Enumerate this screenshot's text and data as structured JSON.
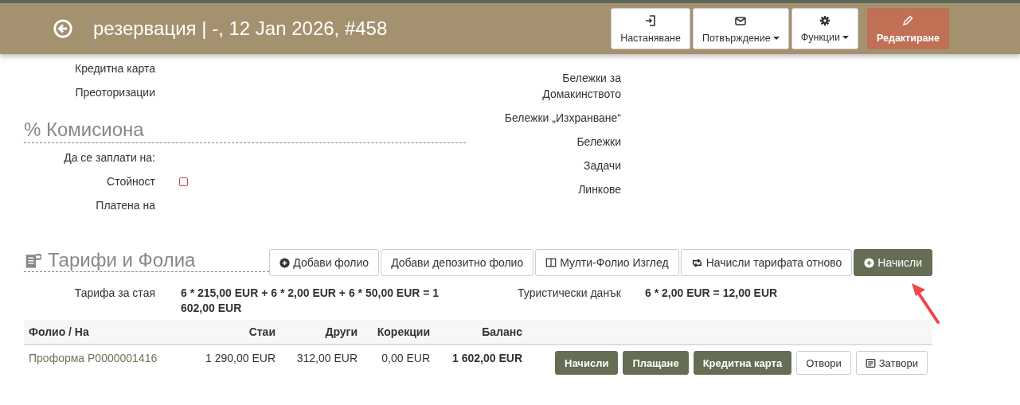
{
  "header": {
    "title": "резервация | -, 12 Jan 2026, #458",
    "actions": [
      {
        "label": "Настаняване",
        "dropdown": false,
        "kind": "default"
      },
      {
        "label": "Потвърждение",
        "dropdown": true,
        "kind": "default"
      },
      {
        "label": "Функции",
        "dropdown": true,
        "kind": "default"
      },
      {
        "label": "Редактиране",
        "dropdown": false,
        "kind": "danger"
      }
    ]
  },
  "details_left": [
    {
      "label": "Кредитна карта"
    },
    {
      "label": "Преоторизации"
    }
  ],
  "commission": {
    "title": "% Комисиона",
    "fields": [
      {
        "label": "Да се заплати на:",
        "kind": "text"
      },
      {
        "label": "Стойност",
        "kind": "checkbox",
        "checked": false
      },
      {
        "label": "Платена на",
        "kind": "text"
      }
    ]
  },
  "details_right": [
    {
      "label": "Бележки за Домакинството"
    },
    {
      "label": "Бележки „Изхранване“"
    },
    {
      "label": "Бележки"
    },
    {
      "label": "Задачи"
    },
    {
      "label": "Линкове"
    }
  ],
  "rates": {
    "title": "Тарифи и Фолиа",
    "actions": [
      {
        "label": "Добави фолио",
        "kind": "default"
      },
      {
        "label": "Добави депозитно фолио",
        "kind": "default"
      },
      {
        "label": "Мулти-Фолио Изглед",
        "kind": "default"
      },
      {
        "label": "Начисли тарифата отново",
        "kind": "default"
      },
      {
        "label": "Начисли",
        "kind": "primary"
      }
    ],
    "lines": [
      {
        "label": "Тарифа за стая",
        "value": "6 * 215,00 EUR + 6 * 2,00 EUR + 6 * 50,00 EUR = 1 602,00 EUR"
      },
      {
        "label": "Туристически данък",
        "value": "6 * 2,00 EUR = 12,00 EUR"
      }
    ],
    "table": {
      "columns": [
        "Фолио / На",
        "Стаи",
        "Други",
        "Корекции",
        "Баланс"
      ],
      "rows": [
        {
          "cells": [
            "Проформа P0000001416",
            "1 290,00 EUR",
            "312,00 EUR",
            "0,00 EUR",
            "1 602,00 EUR"
          ],
          "actions": [
            {
              "label": "Начисли",
              "kind": "primary"
            },
            {
              "label": "Плащане",
              "kind": "primary"
            },
            {
              "label": "Кредитна карта",
              "kind": "primary"
            },
            {
              "label": "Отвори",
              "kind": "default"
            },
            {
              "label": "Затвори",
              "kind": "default"
            }
          ]
        }
      ]
    }
  }
}
